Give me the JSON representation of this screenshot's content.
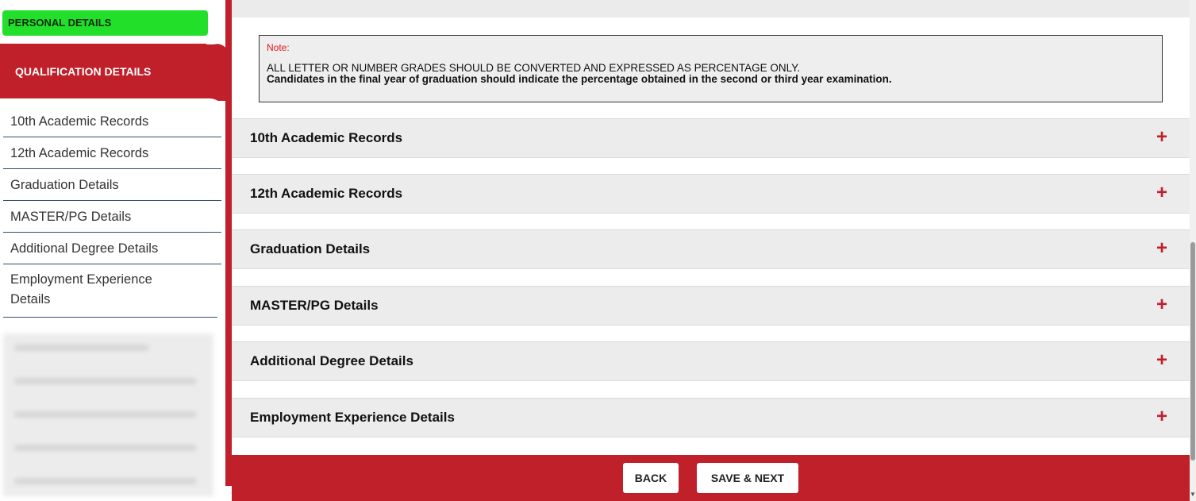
{
  "sidebar": {
    "personal_details": "PERSONAL DETAILS",
    "qualification_header": "QUALIFICATION DETAILS",
    "items": [
      {
        "label": "10th Academic Records"
      },
      {
        "label": "12th Academic Records"
      },
      {
        "label": "Graduation Details"
      },
      {
        "label": "MASTER/PG Details"
      },
      {
        "label": "Additional Degree Details"
      },
      {
        "label": "Employment Experience Details"
      }
    ]
  },
  "note": {
    "title": "Note:",
    "line1": "ALL LETTER OR NUMBER GRADES SHOULD BE CONVERTED AND EXPRESSED AS PERCENTAGE ONLY.",
    "line2": "Candidates in the final year of graduation should indicate the percentage obtained in the second or third year examination."
  },
  "sections": [
    {
      "title": "10th Academic Records",
      "icon": "plus-icon"
    },
    {
      "title": "12th Academic Records",
      "icon": "plus-icon"
    },
    {
      "title": "Graduation Details",
      "icon": "plus-icon"
    },
    {
      "title": "MASTER/PG Details",
      "icon": "plus-icon"
    },
    {
      "title": "Additional Degree Details",
      "icon": "plus-icon"
    },
    {
      "title": "Employment Experience Details",
      "icon": "plus-icon"
    }
  ],
  "footer": {
    "back_label": "BACK",
    "save_next_label": "SAVE & NEXT"
  },
  "colors": {
    "brand_red": "#c0202a",
    "active_green": "#22e02a",
    "note_red": "#e0141e"
  }
}
